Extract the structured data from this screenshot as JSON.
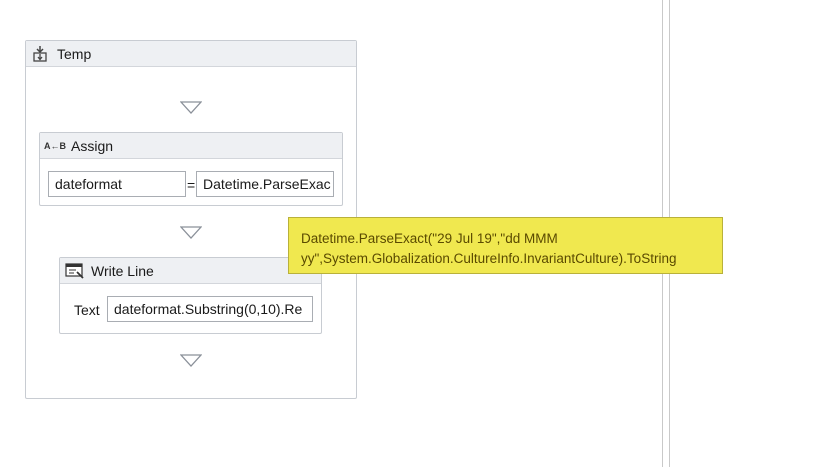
{
  "sequence": {
    "title": "Temp",
    "icon": "sequence-icon"
  },
  "assign": {
    "title": "Assign",
    "icon_text": "A←B",
    "to_value": "dateformat",
    "equals": "=",
    "value": "Datetime.ParseExac"
  },
  "write_line": {
    "title": "Write Line",
    "icon": "write-line-icon",
    "text_label": "Text",
    "text_value": "dateformat.Substring(0,10).Re"
  },
  "tooltip": {
    "line1": "Datetime.ParseExact(\"29 Jul 19\",\"dd MMM",
    "line2": "yy\",System.Globalization.CultureInfo.InvariantCulture).ToString"
  },
  "colors": {
    "header_bg": "#eef0f3",
    "border": "#c8ccd2",
    "tooltip_bg": "#f0e84f",
    "tooltip_text": "#5a4a00",
    "arrow": "#8a9099"
  }
}
